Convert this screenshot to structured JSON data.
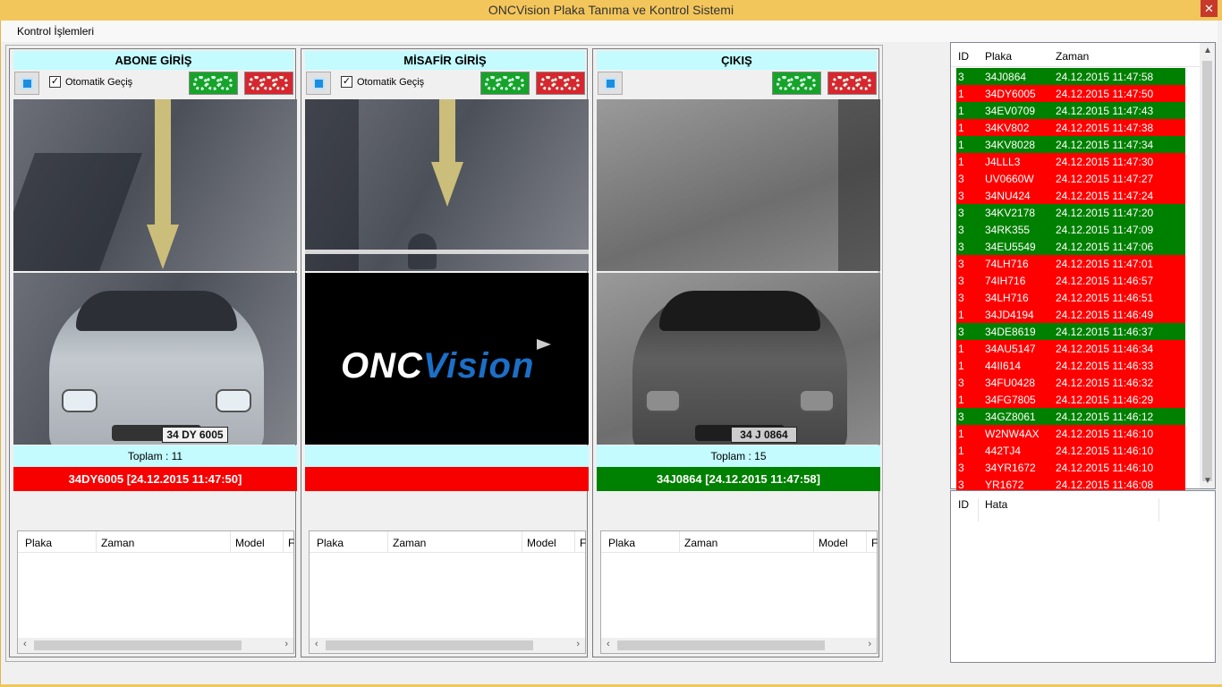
{
  "window": {
    "title": "ONCVision Plaka Tanıma ve Kontrol Sistemi",
    "close": "✕"
  },
  "menu": {
    "items": [
      "Kontrol İşlemleri"
    ]
  },
  "panels": [
    {
      "title": "ABONE GİRİŞ",
      "checkbox_label": "Otomatik Geçiş",
      "checked": true,
      "has_checkbox": true,
      "plate_text": "34 DY 6005",
      "total": "Toplam :  11",
      "status": "34DY6005 [24.12.2015 11:47:50]",
      "status_color": "#f70000"
    },
    {
      "title": "MİSAFİR GİRİŞ",
      "checkbox_label": "Otomatik Geçiş",
      "checked": true,
      "has_checkbox": true,
      "logo_text": "ONC",
      "logo_accent": "Vision",
      "total": "",
      "status": "",
      "status_color": "#f70000"
    },
    {
      "title": "ÇIKIŞ",
      "has_checkbox": false,
      "plate_text": "34 J 0864",
      "total": "Toplam :  15",
      "status": "34J0864 [24.12.2015 11:47:58]",
      "status_color": "#008000"
    }
  ],
  "list_columns": [
    "Plaka",
    "Zaman",
    "Model",
    "F"
  ],
  "grid": {
    "columns": [
      "ID",
      "Plaka",
      "Zaman"
    ],
    "rows": [
      {
        "id": "3",
        "plaka": "34J0864",
        "zaman": "24.12.2015 11:47:58",
        "color": "green"
      },
      {
        "id": "1",
        "plaka": "34DY6005",
        "zaman": "24.12.2015 11:47:50",
        "color": "red"
      },
      {
        "id": "1",
        "plaka": "34EV0709",
        "zaman": "24.12.2015 11:47:43",
        "color": "green"
      },
      {
        "id": "1",
        "plaka": "34KV802",
        "zaman": "24.12.2015 11:47:38",
        "color": "red"
      },
      {
        "id": "1",
        "plaka": "34KV8028",
        "zaman": "24.12.2015 11:47:34",
        "color": "green"
      },
      {
        "id": "1",
        "plaka": "J4LLL3",
        "zaman": "24.12.2015 11:47:30",
        "color": "red"
      },
      {
        "id": "3",
        "plaka": "UV0660W",
        "zaman": "24.12.2015 11:47:27",
        "color": "red"
      },
      {
        "id": "3",
        "plaka": "34NU424",
        "zaman": "24.12.2015 11:47:24",
        "color": "red"
      },
      {
        "id": "3",
        "plaka": "34KV2178",
        "zaman": "24.12.2015 11:47:20",
        "color": "green"
      },
      {
        "id": "3",
        "plaka": "34RK355",
        "zaman": "24.12.2015 11:47:09",
        "color": "green"
      },
      {
        "id": "3",
        "plaka": "34EU5549",
        "zaman": "24.12.2015 11:47:06",
        "color": "green"
      },
      {
        "id": "3",
        "plaka": "74LH716",
        "zaman": "24.12.2015 11:47:01",
        "color": "red"
      },
      {
        "id": "3",
        "plaka": "74IH716",
        "zaman": "24.12.2015 11:46:57",
        "color": "red"
      },
      {
        "id": "3",
        "plaka": "34LH716",
        "zaman": "24.12.2015 11:46:51",
        "color": "red"
      },
      {
        "id": "1",
        "plaka": "34JD4194",
        "zaman": "24.12.2015 11:46:49",
        "color": "red"
      },
      {
        "id": "3",
        "plaka": "34DE8619",
        "zaman": "24.12.2015 11:46:37",
        "color": "green"
      },
      {
        "id": "1",
        "plaka": "34AU5147",
        "zaman": "24.12.2015 11:46:34",
        "color": "red"
      },
      {
        "id": "1",
        "plaka": "44II614",
        "zaman": "24.12.2015 11:46:33",
        "color": "red"
      },
      {
        "id": "3",
        "plaka": "34FU0428",
        "zaman": "24.12.2015 11:46:32",
        "color": "red"
      },
      {
        "id": "1",
        "plaka": "34FG7805",
        "zaman": "24.12.2015 11:46:29",
        "color": "red"
      },
      {
        "id": "3",
        "plaka": "34GZ8061",
        "zaman": "24.12.2015 11:46:12",
        "color": "green"
      },
      {
        "id": "1",
        "plaka": "W2NW4AX",
        "zaman": "24.12.2015 11:46:10",
        "color": "red"
      },
      {
        "id": "1",
        "plaka": "442TJ4",
        "zaman": "24.12.2015 11:46:10",
        "color": "red"
      },
      {
        "id": "3",
        "plaka": "34YR1672",
        "zaman": "24.12.2015 11:46:10",
        "color": "red"
      },
      {
        "id": "3",
        "plaka": "YR1672",
        "zaman": "24.12.2015 11:46:08",
        "color": "red"
      }
    ]
  },
  "errors": {
    "columns": [
      "ID",
      "Hata"
    ]
  },
  "colors": {
    "row_red": "#ff0000",
    "row_green": "#008000",
    "header_cyan": "#c3fbff",
    "titlebar": "#f3c65c"
  }
}
